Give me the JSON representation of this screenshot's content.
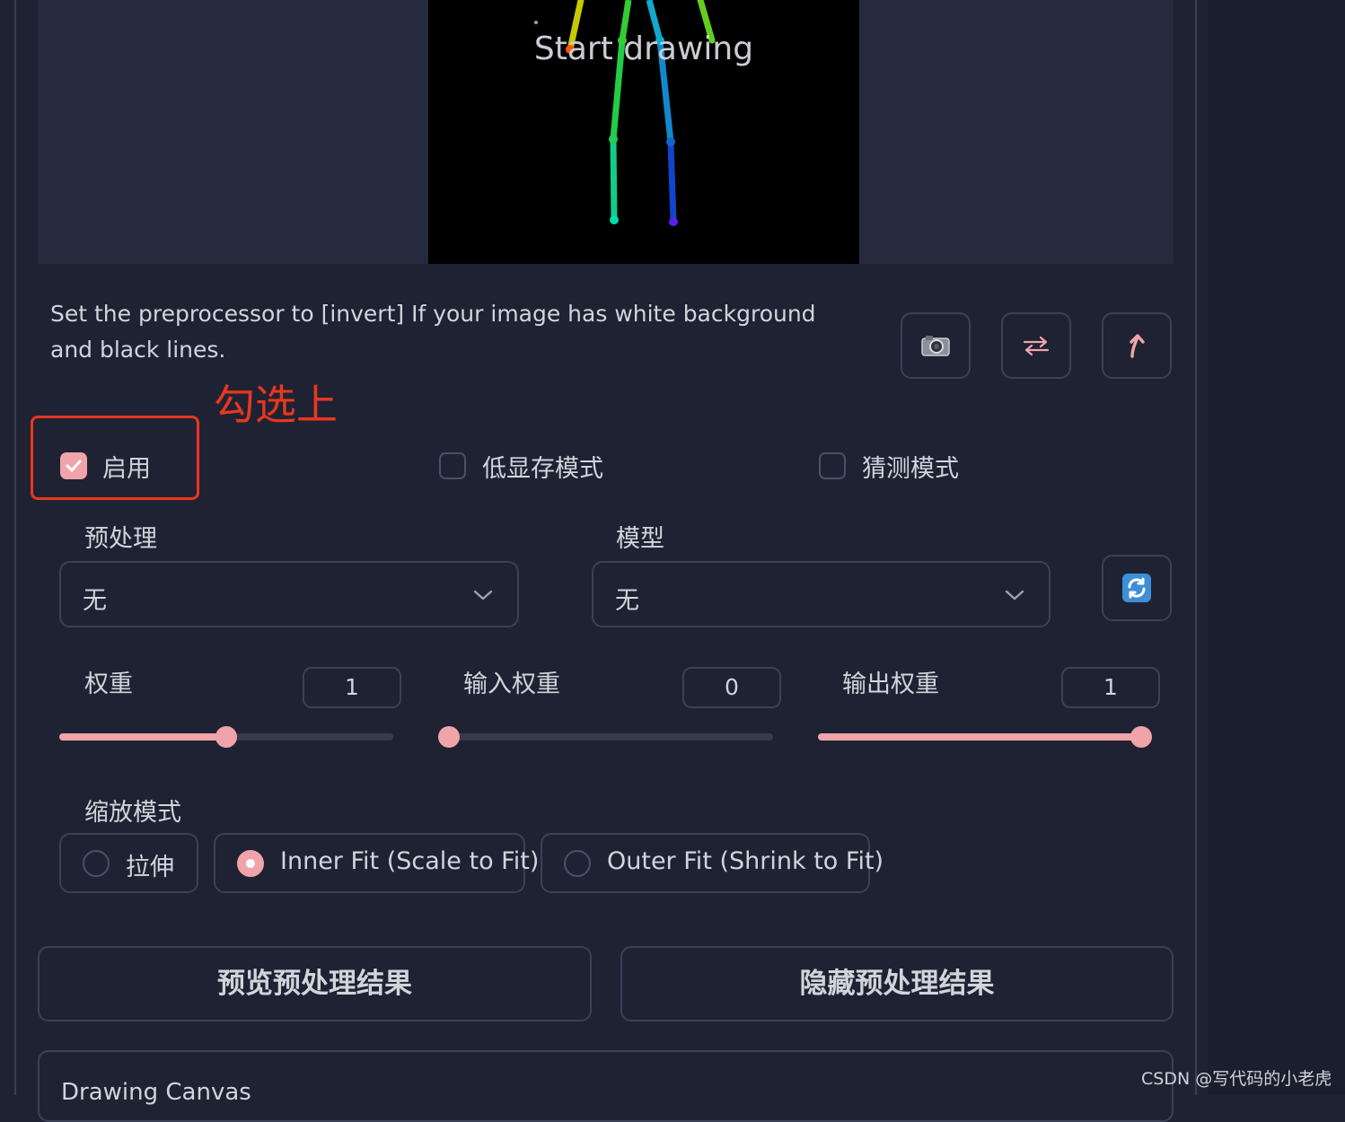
{
  "canvas": {
    "overlay_text": "Start drawing"
  },
  "description": "Set the preprocessor to [invert] If your image has white background and black lines.",
  "tools": {
    "camera_icon": "camera-icon",
    "swap_icon": "swap-icon",
    "send_icon": "send-up-icon"
  },
  "annotation": {
    "text": "勾选上",
    "color": "#e8371f"
  },
  "checkboxes": [
    {
      "label": "启用",
      "checked": true
    },
    {
      "label": "低显存模式",
      "checked": false
    },
    {
      "label": "猜测模式",
      "checked": false
    }
  ],
  "preprocessor": {
    "label": "预处理",
    "value": "无"
  },
  "model": {
    "label": "模型",
    "value": "无"
  },
  "refresh_icon": "refresh-icon",
  "sliders": [
    {
      "label": "权重",
      "value": "1",
      "level": 0.5
    },
    {
      "label": "输入权重",
      "value": "0",
      "level": 0.0
    },
    {
      "label": "输出权重",
      "value": "1",
      "level": 1.0
    }
  ],
  "resize_mode": {
    "label": "缩放模式",
    "options": [
      "拉伸",
      "Inner Fit (Scale to Fit)",
      "Outer Fit (Shrink to Fit)"
    ],
    "selected": "Inner Fit (Scale to Fit)"
  },
  "buttons": {
    "preview": "预览预处理结果",
    "hide": "隐藏预处理结果"
  },
  "drawing_canvas": {
    "title": "Drawing Canvas"
  },
  "watermark": "CSDN @写代码的小老虎",
  "colors": {
    "accent": "#f0a4aa",
    "background": "#1f2233",
    "border": "#3b4157"
  }
}
